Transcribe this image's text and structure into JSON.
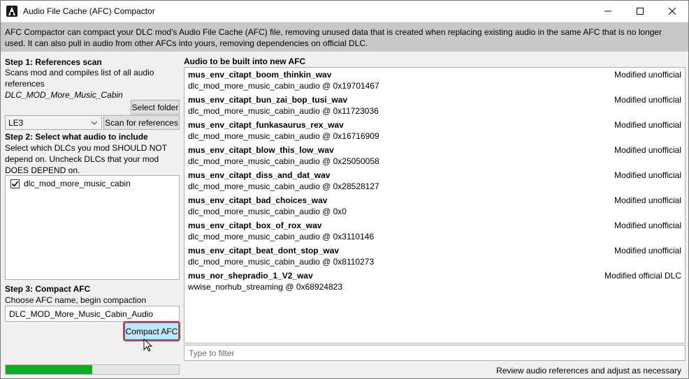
{
  "window": {
    "title": "Audio File Cache (AFC) Compactor"
  },
  "description": "AFC Compactor can compact your DLC mod's Audio File Cache (AFC) file, removing unused data that is created when replacing existing audio in the same AFC that is no longer used. It can also pull in audio from other AFCs into yours, removing dependencies on official DLC.",
  "step1": {
    "heading": "Step 1: References scan",
    "text": "Scans mod and compiles list of all audio references",
    "mod_name": "DLC_MOD_More_Music_Cabin",
    "select_folder_label": "Select folder",
    "game_selected": "LE3",
    "scan_label": "Scan for references"
  },
  "step2": {
    "heading": "Step 2: Select what audio to include",
    "text": "Select which DLCs you mod SHOULD NOT depend on. Uncheck DLCs that your mod DOES DEPEND on.",
    "dlcs": [
      {
        "name": "dlc_mod_more_music_cabin",
        "checked": true
      }
    ]
  },
  "step3": {
    "heading": "Step 3: Compact AFC",
    "text": "Choose AFC name, begin compaction",
    "afc_name": "DLC_MOD_More_Music_Cabin_Audio",
    "compact_label": "Compact AFC"
  },
  "audio": {
    "heading": "Audio to be built into new AFC",
    "items": [
      {
        "name": "mus_env_citapt_boom_thinkin_wav",
        "ref": "dlc_mod_more_music_cabin_audio @ 0x19701467",
        "status": "Modified unofficial"
      },
      {
        "name": "mus_env_citapt_bun_zai_bop_tusi_wav",
        "ref": "dlc_mod_more_music_cabin_audio @ 0x11723036",
        "status": "Modified unofficial"
      },
      {
        "name": "mus_env_citapt_funkasaurus_rex_wav",
        "ref": "dlc_mod_more_music_cabin_audio @ 0x16716909",
        "status": "Modified unofficial"
      },
      {
        "name": "mus_env_citapt_blow_this_low_wav",
        "ref": "dlc_mod_more_music_cabin_audio @ 0x25050058",
        "status": "Modified unofficial"
      },
      {
        "name": "mus_env_citapt_diss_and_dat_wav",
        "ref": "dlc_mod_more_music_cabin_audio @ 0x28528127",
        "status": "Modified unofficial"
      },
      {
        "name": "mus_env_citapt_bad_choices_wav",
        "ref": "dlc_mod_more_music_cabin_audio @ 0x0",
        "status": "Modified unofficial"
      },
      {
        "name": "mus_env_citapt_box_of_rox_wav",
        "ref": "dlc_mod_more_music_cabin_audio @ 0x3110146",
        "status": "Modified unofficial"
      },
      {
        "name": "mus_env_citapt_beat_dont_stop_wav",
        "ref": "dlc_mod_more_music_cabin_audio @ 0x8110273",
        "status": "Modified unofficial"
      },
      {
        "name": "mus_nor_shepradio_1_V2_wav",
        "ref": "wwise_norhub_streaming @ 0x68924823",
        "status": "Modified official DLC"
      }
    ],
    "filter_placeholder": "Type to filter"
  },
  "status": {
    "progress_fraction": 0.5,
    "text": "Review audio references and adjust as necessary"
  },
  "colors": {
    "description_bg": "#c8c8c8",
    "progress_fill": "#06b025",
    "highlight_border": "#e0303a",
    "button_active_bg": "#bee6fd"
  }
}
